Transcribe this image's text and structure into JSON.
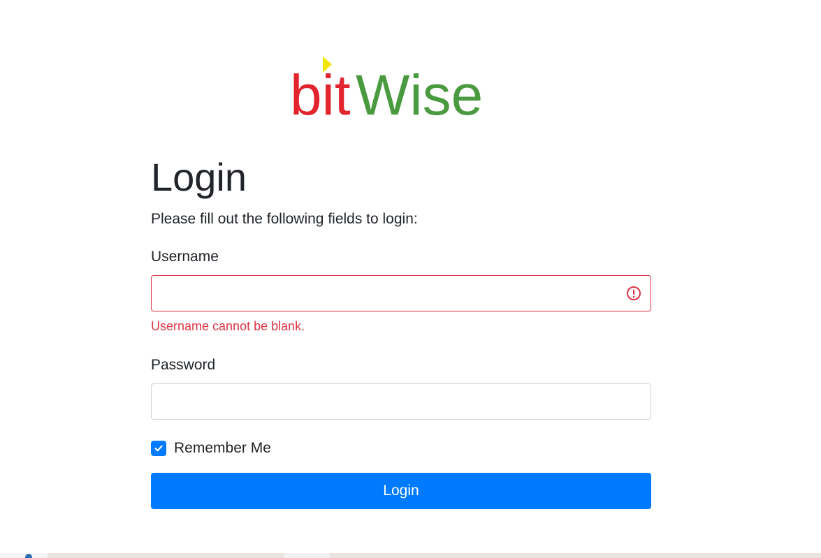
{
  "logo": {
    "text_part1": "bit",
    "text_part2": "Wise",
    "colors": {
      "bit": "#e2242f",
      "wise": "#4a9a3f",
      "accent": "#f2e600"
    }
  },
  "header": {
    "title": "Login",
    "subtitle": "Please fill out the following fields to login:"
  },
  "form": {
    "username": {
      "label": "Username",
      "value": "",
      "error": "Username cannot be blank."
    },
    "password": {
      "label": "Password",
      "value": ""
    },
    "remember_me": {
      "label": "Remember Me",
      "checked": true
    },
    "submit_label": "Login"
  },
  "colors": {
    "primary": "#007bff",
    "danger": "#dc3545",
    "text": "#212529",
    "border": "#ced4da"
  },
  "icons": {
    "error": "exclamation-circle-icon",
    "check": "checkmark-icon"
  }
}
